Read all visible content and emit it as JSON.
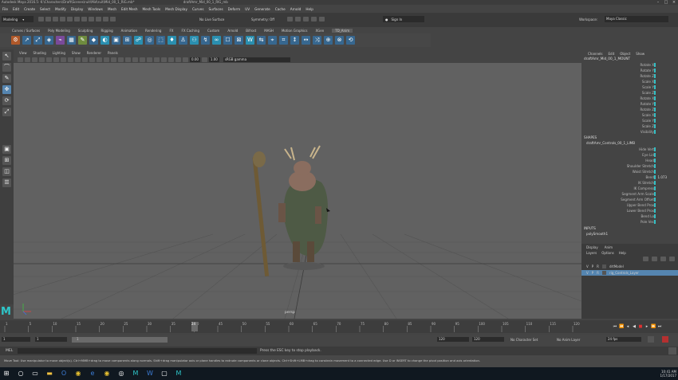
{
  "titlebar": {
    "title": "Autodesk Maya 2016.5: K:\\Characters\\Draft\\Scenes\\ruit\\Mid\\ruit\\Mid_00_1_RIG.mb*",
    "right_text": "draftAmr_Mid_00_1_RIG_mb"
  },
  "menubar": {
    "items": [
      "File",
      "Edit",
      "Create",
      "Select",
      "Modify",
      "Display",
      "Windows",
      "Mesh",
      "Edit Mesh",
      "Mesh Tools",
      "Mesh Display",
      "Curves",
      "Surfaces",
      "Deform",
      "UV",
      "Generate",
      "Cache",
      "Arnold",
      "Help"
    ]
  },
  "statusline": {
    "mode": "Modeling",
    "live_surface": "No Live Surface",
    "symmetry": "Symmetry: Off",
    "sign_in": "Sign In",
    "workspace_label": "Workspace:",
    "workspace_value": "Maya Classic"
  },
  "shelf": {
    "tabs": [
      "Curves / Surfaces",
      "Poly Modeling",
      "Sculpting",
      "Rigging",
      "Animation",
      "Rendering",
      "FX",
      "FX Caching",
      "Custom",
      "Arnold",
      "Bifrost",
      "MASH",
      "Motion Graphics",
      "XGen",
      "TD_Anim"
    ],
    "active_tab": "TD_Anim"
  },
  "viewport": {
    "menu": [
      "View",
      "Shading",
      "Lighting",
      "Show",
      "Renderer",
      "Panels"
    ],
    "field_value_1": "0.00",
    "field_value_2": "1.00",
    "color_space": "sRGB gamma",
    "camera_label": "persp"
  },
  "channel_box": {
    "tabs": [
      "Channels",
      "Edit",
      "Object",
      "Show"
    ],
    "object_name": "draftAmr_Mid_00_1_MOUNT",
    "attributes": [
      "Rotate X",
      "Rotate Y",
      "Rotate Z",
      "Scale X",
      "Scale Y",
      "Scale Z",
      "Rotate X",
      "Rotate Y",
      "Rotate Z",
      "Scale X",
      "Scale Y",
      "Scale Z",
      "Visibility"
    ],
    "shapes_label": "SHAPES",
    "shapes_name": "draftAmr_Controls_00_1_LIMB",
    "shape_attributes": [
      "Hide Vert",
      "Eye Lid",
      "Head",
      "Shoulder Stretch",
      "Waist Stretch",
      "Bend",
      "IK Stretch",
      "IK Compress",
      "Segment Arm Scale",
      "Segment Arm Offset",
      "Upper Bend Prox",
      "Lower Bend Prox",
      "Bend Lo",
      "Pole Vec"
    ],
    "shape_value": "1.073",
    "inputs_label": "INPUTS",
    "inputs_name": "polySmooth1"
  },
  "layer_editor": {
    "tabs": [
      "Display",
      "Anim"
    ],
    "submenu": [
      "Layers",
      "Options",
      "Help"
    ],
    "layers": [
      {
        "v": "V",
        "p": "P",
        "r": "R",
        "name": "drtModel",
        "selected": false
      },
      {
        "v": "V",
        "p": "P",
        "r": "R",
        "name": "rig_Controls_Layer",
        "selected": true
      }
    ]
  },
  "timeline": {
    "ticks": [
      "1",
      "5",
      "10",
      "15",
      "20",
      "25",
      "30",
      "35",
      "40",
      "45",
      "50",
      "55",
      "60",
      "65",
      "70",
      "75",
      "80",
      "85",
      "90",
      "95",
      "100",
      "105",
      "110",
      "115",
      "120"
    ],
    "current_frame": "24"
  },
  "range": {
    "start": "1",
    "anim_start": "1",
    "range_label": "1",
    "range_end": "120",
    "end": "120",
    "anim_end": "120",
    "character_set": "No Character Set",
    "anim_layer": "No Anim Layer",
    "fps": "24 fps"
  },
  "cmdline": {
    "lang": "MEL",
    "message": "Press the ESC key to stop playback."
  },
  "helpline": {
    "text": "Move Tool: Use manipulator to move object(s). Ctrl+MMB+drag to move components along normals. Shift+drag manipulator axis or plane handles to extrude components or clone objects. Ctrl+Shift+LMB+drag to constrain movement to a connected edge. Use D or INSERT to change the pivot position and axis orientation."
  },
  "taskbar": {
    "time": "10:41 AM",
    "date": "1/17/2017"
  },
  "colors": {
    "viewport_bg": "#616161",
    "accent": "#2ec6c9",
    "selection": "#5585b0"
  }
}
